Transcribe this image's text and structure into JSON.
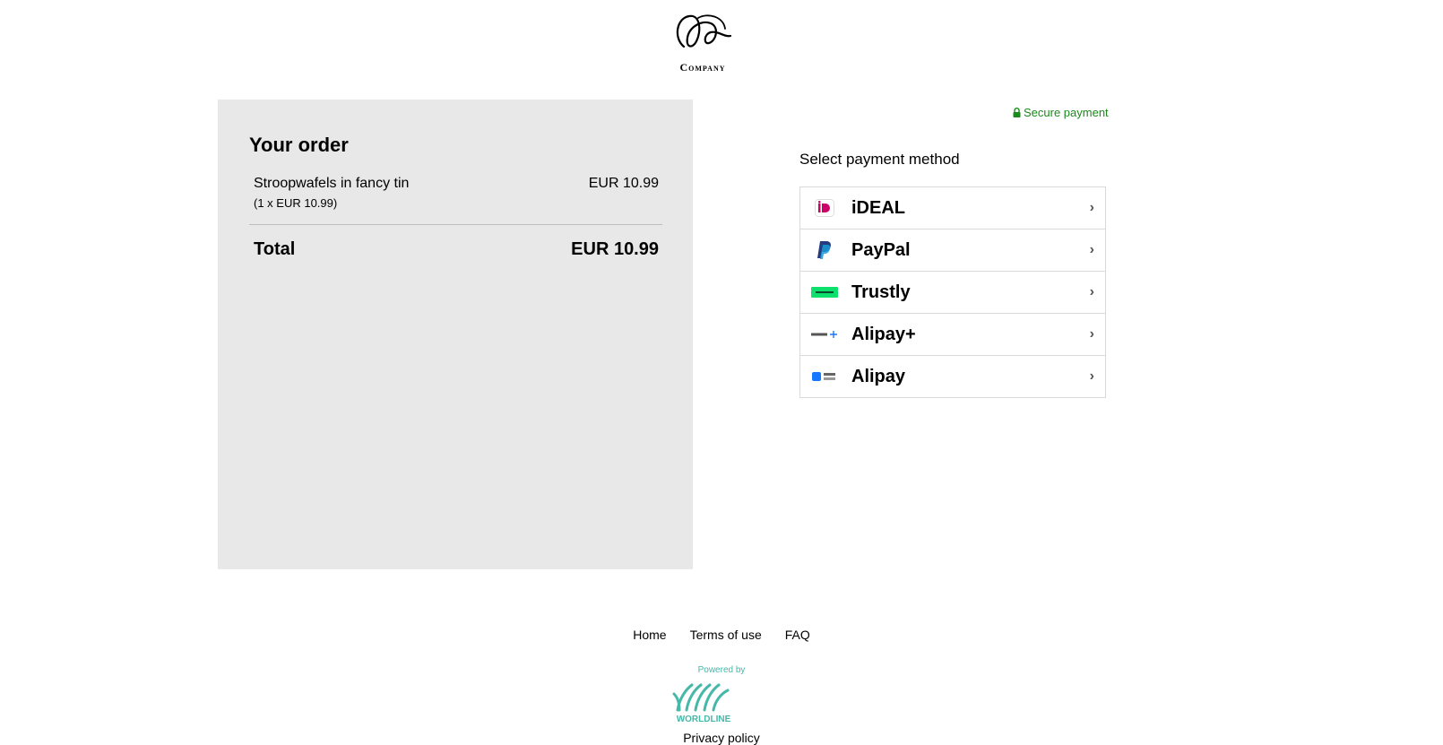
{
  "brand": {
    "company_name": "Company"
  },
  "order": {
    "title": "Your order",
    "items": [
      {
        "name": "Stroopwafels in fancy tin",
        "detail": "(1 x EUR 10.99)",
        "price": "EUR 10.99"
      }
    ],
    "total_label": "Total",
    "total_value": "EUR 10.99"
  },
  "payment": {
    "secure_label": "Secure payment",
    "heading": "Select payment method",
    "methods": [
      {
        "label": "iDEAL",
        "icon": "ideal-icon"
      },
      {
        "label": "PayPal",
        "icon": "paypal-icon"
      },
      {
        "label": "Trustly",
        "icon": "trustly-icon"
      },
      {
        "label": "Alipay+",
        "icon": "alipay-plus-icon"
      },
      {
        "label": "Alipay",
        "icon": "alipay-icon"
      }
    ]
  },
  "footer": {
    "links": [
      {
        "label": "Home"
      },
      {
        "label": "Terms of use"
      },
      {
        "label": "FAQ"
      }
    ],
    "powered_by": "Powered by",
    "provider_logo_text": "WORLDLINE",
    "privacy_label": "Privacy policy"
  },
  "colors": {
    "secure_green": "#1a8a1a",
    "panel_bg": "#e8e8e8",
    "worldline_teal": "#46b8a8"
  }
}
